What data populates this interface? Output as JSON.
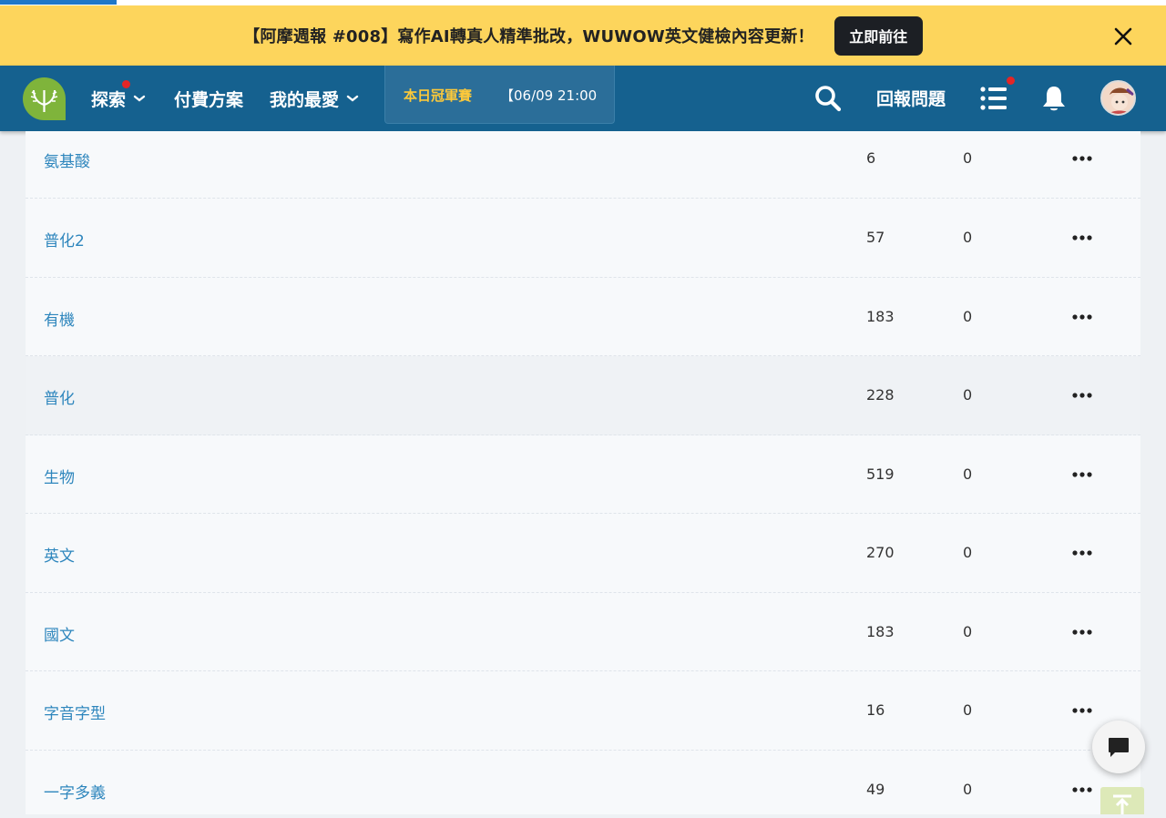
{
  "banner": {
    "text": "【阿摩週報 #008】寫作AI轉真人精準批改，WUWOW英文健檢內容更新！",
    "button_label": "立即前往"
  },
  "nav": {
    "explore_label": "探索",
    "pricing_label": "付費方案",
    "favorites_label": "我的最愛",
    "marquee_label": "本日冠軍賽",
    "marquee_text": "【06/09 21:00",
    "report_label": "回報問題"
  },
  "table": {
    "rows": [
      {
        "name": "氨基酸",
        "count": "6",
        "zero": "0"
      },
      {
        "name": "普化2",
        "count": "57",
        "zero": "0"
      },
      {
        "name": "有機",
        "count": "183",
        "zero": "0"
      },
      {
        "name": "普化",
        "count": "228",
        "zero": "0"
      },
      {
        "name": "生物",
        "count": "519",
        "zero": "0"
      },
      {
        "name": "英文",
        "count": "270",
        "zero": "0"
      },
      {
        "name": "國文",
        "count": "183",
        "zero": "0"
      },
      {
        "name": "字音字型",
        "count": "16",
        "zero": "0"
      },
      {
        "name": "一字多義",
        "count": "49",
        "zero": "0"
      }
    ]
  },
  "colors": {
    "banner_bg": "#fdd55c",
    "navbar_bg": "#15618f",
    "link": "#2e86bd",
    "accent_yellow": "#fcc93a",
    "badge_red": "#e32626"
  },
  "icons": {
    "close": "close-icon",
    "search": "search-icon",
    "list": "list-icon",
    "bell": "bell-icon",
    "more": "more-horizontal-icon",
    "chat": "chat-icon",
    "to_top": "arrow-up-to-top-icon"
  }
}
